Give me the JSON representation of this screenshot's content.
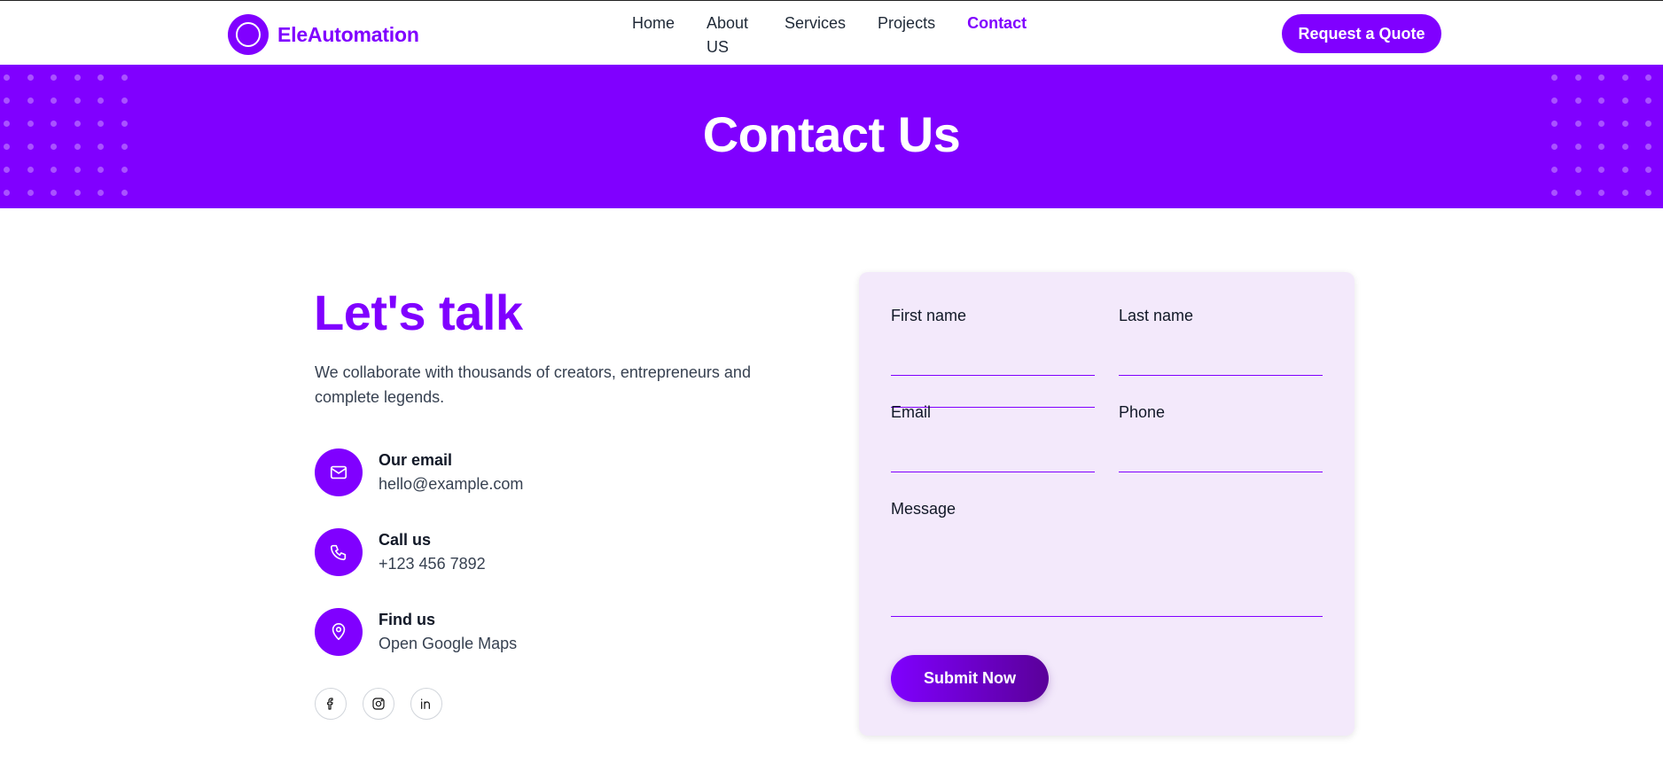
{
  "header": {
    "logo_text": "EleAutomation",
    "nav": [
      {
        "label": "Home"
      },
      {
        "label": "About US"
      },
      {
        "label": "Services"
      },
      {
        "label": "Projects"
      },
      {
        "label": "Contact",
        "active": true
      }
    ],
    "quote_button": "Request a Quote"
  },
  "banner": {
    "title": "Contact Us"
  },
  "intro": {
    "title": "Let's talk",
    "description": "We collaborate with thousands of creators, entrepreneurs and complete legends."
  },
  "contacts": [
    {
      "icon": "mail-icon",
      "label": "Our email",
      "value": "hello@example.com"
    },
    {
      "icon": "phone-icon",
      "label": "Call us",
      "value": "+123 456 7892"
    },
    {
      "icon": "map-pin-icon",
      "label": "Find us",
      "value": "Open Google Maps"
    }
  ],
  "socials": [
    "facebook-icon",
    "instagram-icon",
    "linkedin-icon"
  ],
  "form": {
    "first_name_label": "First name",
    "last_name_label": "Last name",
    "email_label": "Email",
    "phone_label": "Phone",
    "message_label": "Message",
    "submit_label": "Submit Now"
  },
  "colors": {
    "accent": "#8000ff",
    "form_background": "#f3e9fb",
    "text": "#1f2937"
  }
}
